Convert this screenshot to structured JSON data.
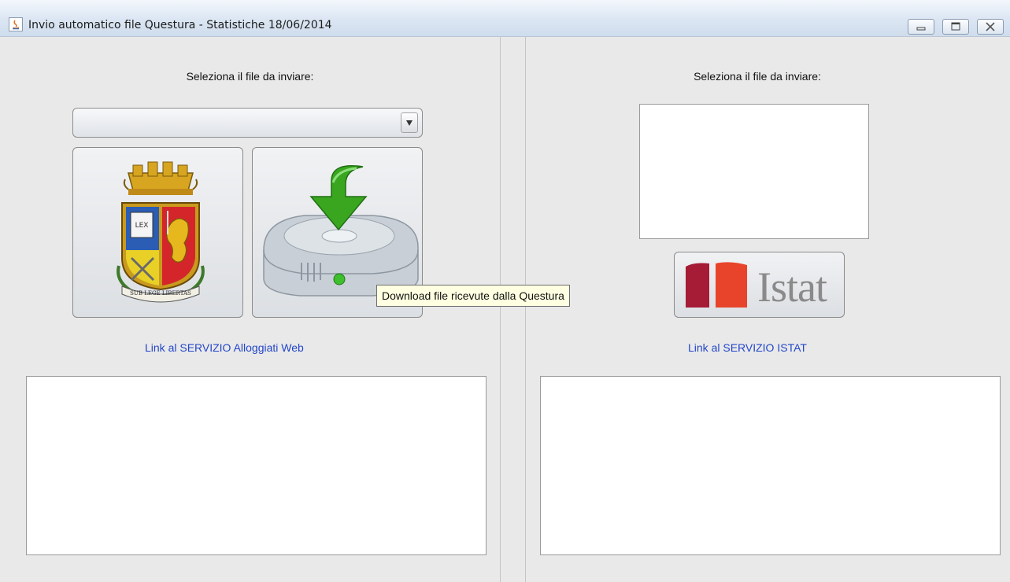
{
  "window": {
    "title": "Invio automatico file Questura - Statistiche 18/06/2014",
    "controls": [
      "minimize",
      "maximize",
      "close"
    ]
  },
  "left_panel": {
    "select_label": "Seleziona il file da inviare:",
    "file_dropdown": {
      "value": ""
    },
    "police_button_icon": "polizia-di-stato-crest-icon",
    "police_crest_motto": "SUB LEGE LIBERTAS",
    "police_crest_book_text": "LEX",
    "download_button_icon": "hard-drive-download-icon",
    "link_label": "Link al SERVIZIO Alloggiati Web",
    "log_text": ""
  },
  "right_panel": {
    "select_label": "Seleziona il file da inviare:",
    "file_list": [],
    "istat_button_text": "Istat",
    "link_label": "Link al SERVIZIO ISTAT",
    "log_text": ""
  },
  "tooltip": {
    "text": "Download file ricevute dalla Questura"
  },
  "colors": {
    "link": "#2346c9",
    "tooltip_bg": "#ffffe1",
    "istat_dark_red": "#a61b36",
    "istat_orange_red": "#e8442b",
    "download_arrow_green": "#3aa61f"
  }
}
